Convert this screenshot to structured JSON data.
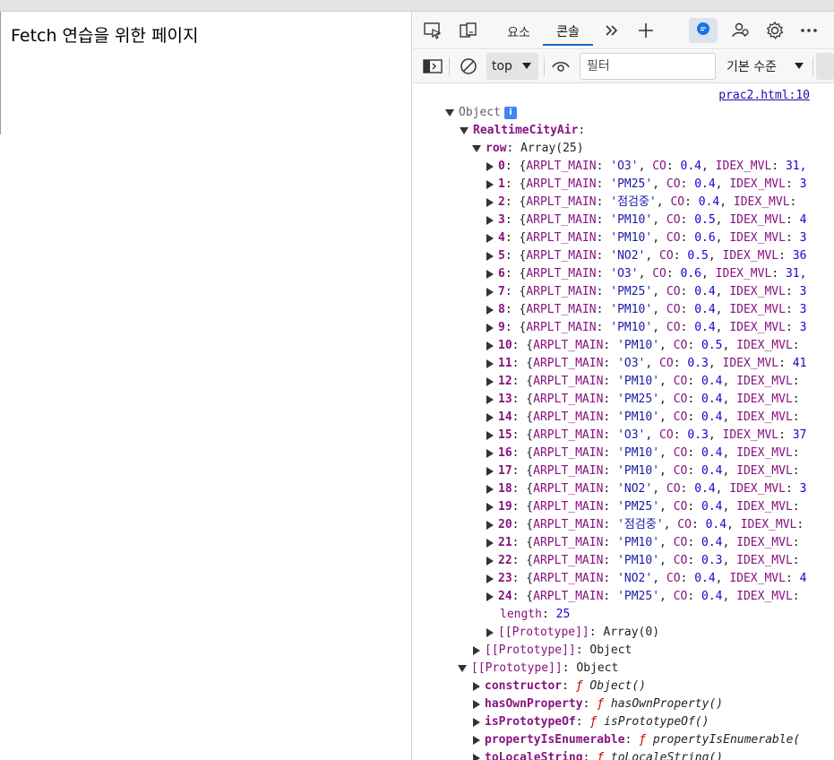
{
  "page": {
    "title": "Fetch 연습을 위한 페이지"
  },
  "devtools": {
    "tabs": [
      {
        "label": "요소",
        "active": false
      },
      {
        "label": "콘솔",
        "active": true
      }
    ],
    "toolbar": {
      "context": "top",
      "filter_placeholder": "필터",
      "levels": "기본 수준"
    },
    "icons": [
      "inspect-icon",
      "device-emulation-icon",
      "more-tabs-icon",
      "add-tab-icon",
      "feedback-icon",
      "connected-devices-icon",
      "settings-icon",
      "more-options-icon",
      "sidebar-toggle-icon",
      "clear-console-icon",
      "live-expression-icon",
      "console-settings-icon"
    ]
  },
  "console": {
    "source_link": "prac2.html:10",
    "object_label": "Object",
    "info_badge": "i",
    "realtime_key": "RealtimeCityAir",
    "row_key": "row",
    "row_type": "Array(25)",
    "rows": [
      {
        "index": "0",
        "ARPLT_MAIN": "'O3'",
        "CO": "0.4",
        "IDEX_MVL": "31,"
      },
      {
        "index": "1",
        "ARPLT_MAIN": "'PM25'",
        "CO": "0.4",
        "IDEX_MVL": "3"
      },
      {
        "index": "2",
        "ARPLT_MAIN": "'점검중'",
        "CO": "0.4",
        "IDEX_MVL": ""
      },
      {
        "index": "3",
        "ARPLT_MAIN": "'PM10'",
        "CO": "0.5",
        "IDEX_MVL": "4"
      },
      {
        "index": "4",
        "ARPLT_MAIN": "'PM10'",
        "CO": "0.6",
        "IDEX_MVL": "3"
      },
      {
        "index": "5",
        "ARPLT_MAIN": "'NO2'",
        "CO": "0.5",
        "IDEX_MVL": "36"
      },
      {
        "index": "6",
        "ARPLT_MAIN": "'O3'",
        "CO": "0.6",
        "IDEX_MVL": "31,"
      },
      {
        "index": "7",
        "ARPLT_MAIN": "'PM25'",
        "CO": "0.4",
        "IDEX_MVL": "3"
      },
      {
        "index": "8",
        "ARPLT_MAIN": "'PM10'",
        "CO": "0.4",
        "IDEX_MVL": "3"
      },
      {
        "index": "9",
        "ARPLT_MAIN": "'PM10'",
        "CO": "0.4",
        "IDEX_MVL": "3"
      },
      {
        "index": "10",
        "ARPLT_MAIN": "'PM10'",
        "CO": "0.5",
        "IDEX_MVL": ""
      },
      {
        "index": "11",
        "ARPLT_MAIN": "'O3'",
        "CO": "0.3",
        "IDEX_MVL": "41"
      },
      {
        "index": "12",
        "ARPLT_MAIN": "'PM10'",
        "CO": "0.4",
        "IDEX_MVL": ""
      },
      {
        "index": "13",
        "ARPLT_MAIN": "'PM25'",
        "CO": "0.4",
        "IDEX_MVL": ""
      },
      {
        "index": "14",
        "ARPLT_MAIN": "'PM10'",
        "CO": "0.4",
        "IDEX_MVL": ""
      },
      {
        "index": "15",
        "ARPLT_MAIN": "'O3'",
        "CO": "0.3",
        "IDEX_MVL": "37"
      },
      {
        "index": "16",
        "ARPLT_MAIN": "'PM10'",
        "CO": "0.4",
        "IDEX_MVL": ""
      },
      {
        "index": "17",
        "ARPLT_MAIN": "'PM10'",
        "CO": "0.4",
        "IDEX_MVL": ""
      },
      {
        "index": "18",
        "ARPLT_MAIN": "'NO2'",
        "CO": "0.4",
        "IDEX_MVL": "3"
      },
      {
        "index": "19",
        "ARPLT_MAIN": "'PM25'",
        "CO": "0.4",
        "IDEX_MVL": ""
      },
      {
        "index": "20",
        "ARPLT_MAIN": "'점검중'",
        "CO": "0.4",
        "IDEX_MVL": ""
      },
      {
        "index": "21",
        "ARPLT_MAIN": "'PM10'",
        "CO": "0.4",
        "IDEX_MVL": ""
      },
      {
        "index": "22",
        "ARPLT_MAIN": "'PM10'",
        "CO": "0.3",
        "IDEX_MVL": ""
      },
      {
        "index": "23",
        "ARPLT_MAIN": "'NO2'",
        "CO": "0.4",
        "IDEX_MVL": "4"
      },
      {
        "index": "24",
        "ARPLT_MAIN": "'PM25'",
        "CO": "0.4",
        "IDEX_MVL": ""
      }
    ],
    "length_key": "length",
    "length_value": "25",
    "proto_array": "Array(0)",
    "proto_object": "Object",
    "proto_key": "[[Prototype]]",
    "methods": [
      {
        "key": "constructor",
        "fn": "Object()"
      },
      {
        "key": "hasOwnProperty",
        "fn": "hasOwnProperty()"
      },
      {
        "key": "isPrototypeOf",
        "fn": "isPrototypeOf()"
      },
      {
        "key": "propertyIsEnumerable",
        "fn": "propertyIsEnumerable("
      },
      {
        "key": "toLocaleString",
        "fn": "toLocaleString()"
      }
    ]
  }
}
